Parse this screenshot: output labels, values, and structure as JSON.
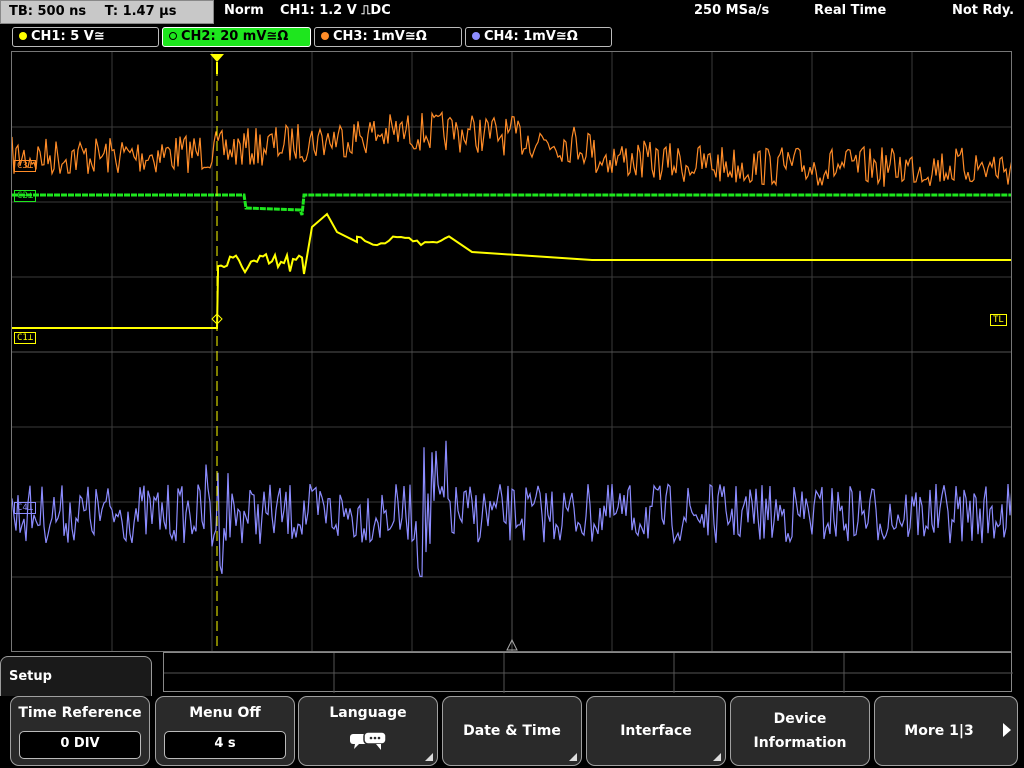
{
  "status": {
    "timebase": "TB: 500 ns",
    "trigger_time": "T: 1.47 µs",
    "trigger_mode": "Norm",
    "trigger_info": "CH1: 1.2 V ⎍DC",
    "sample_rate": "250 MSa/s",
    "acq_mode": "Real Time",
    "state": "Not Rdy."
  },
  "channels": [
    {
      "label": "CH1: 5 V≅",
      "color": "#ffff00"
    },
    {
      "label": "CH2: 20 mV≅Ω",
      "color": "#1ee61e"
    },
    {
      "label": "CH3: 1mV≅Ω",
      "color": "#ff8c28"
    },
    {
      "label": "CH4: 1mV≅Ω",
      "color": "#8c8cff"
    }
  ],
  "markers": {
    "c1": "C1⊥",
    "c2": "C2⊥",
    "c3": "C3⊥",
    "c4": "C4⊥",
    "tl": "TL"
  },
  "menu": {
    "title": "Setup",
    "softkeys": [
      {
        "label": "Time Reference",
        "value": "0 DIV"
      },
      {
        "label": "Menu Off",
        "value": "4 s"
      },
      {
        "label": "Language",
        "icon": "speech-bubbles-icon"
      },
      {
        "label": "Date & Time"
      },
      {
        "label": "Interface"
      },
      {
        "label": "Device",
        "label2": "Information"
      },
      {
        "label": "More 1|3"
      }
    ]
  }
}
